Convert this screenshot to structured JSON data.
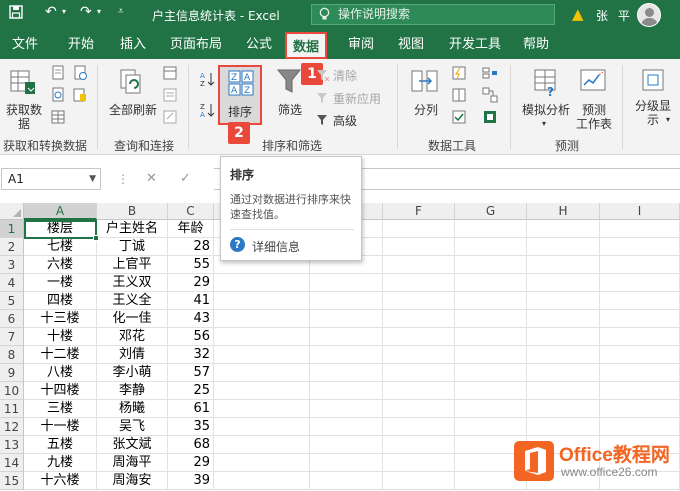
{
  "titlebar": {
    "title": "户主信息统计表 - Excel",
    "search_placeholder": "操作说明搜索",
    "user": "张 平"
  },
  "tabs": [
    "文件",
    "开始",
    "插入",
    "页面布局",
    "公式",
    "数据",
    "审阅",
    "视图",
    "开发工具",
    "帮助"
  ],
  "active_tab": "数据",
  "ribbon": {
    "get_data": "获取数\n据",
    "refresh_all": "全部刷新",
    "sort": "排序",
    "filter": "筛选",
    "clear": "清除",
    "reapply": "重新应用",
    "advanced": "高级",
    "split": "分列",
    "what_if": "模拟分析",
    "forecast": "预测\n工作表",
    "outline": "分级显\n示",
    "groups": {
      "get_transform": "获取和转换数据",
      "queries": "查询和连接",
      "sort_filter": "排序和筛选",
      "data_tools": "数据工具",
      "forecast": "预测"
    }
  },
  "badges": [
    "1",
    "2"
  ],
  "tooltip": {
    "title": "排序",
    "desc": "通过对数据进行排序来快速查找值。",
    "more": "详细信息"
  },
  "formula_bar": {
    "name_box": "A1",
    "formula": ""
  },
  "columns": [
    "A",
    "B",
    "C",
    "D",
    "E",
    "F",
    "G",
    "H",
    "I"
  ],
  "table": {
    "rows": [
      [
        "楼层",
        "户主姓名",
        "年龄"
      ],
      [
        "七楼",
        "丁诚",
        "28"
      ],
      [
        "六楼",
        "上官平",
        "55"
      ],
      [
        "一楼",
        "王义双",
        "29"
      ],
      [
        "四楼",
        "王义全",
        "41"
      ],
      [
        "十三楼",
        "化一佳",
        "43"
      ],
      [
        "十楼",
        "邓花",
        "56"
      ],
      [
        "十二楼",
        "刘倩",
        "32"
      ],
      [
        "八楼",
        "李小萌",
        "57"
      ],
      [
        "十四楼",
        "李静",
        "25"
      ],
      [
        "三楼",
        "杨曦",
        "61"
      ],
      [
        "十一楼",
        "吴飞",
        "35"
      ],
      [
        "五楼",
        "张文斌",
        "68"
      ],
      [
        "九楼",
        "周海平",
        "29"
      ],
      [
        "十六楼",
        "周海安",
        "39"
      ]
    ]
  },
  "watermark": {
    "brand": "Office教程网",
    "url": "www.office26.com"
  },
  "colors": {
    "excel_green": "#217346",
    "highlight_red": "#e8493b",
    "watermark_orange": "#f26522"
  }
}
